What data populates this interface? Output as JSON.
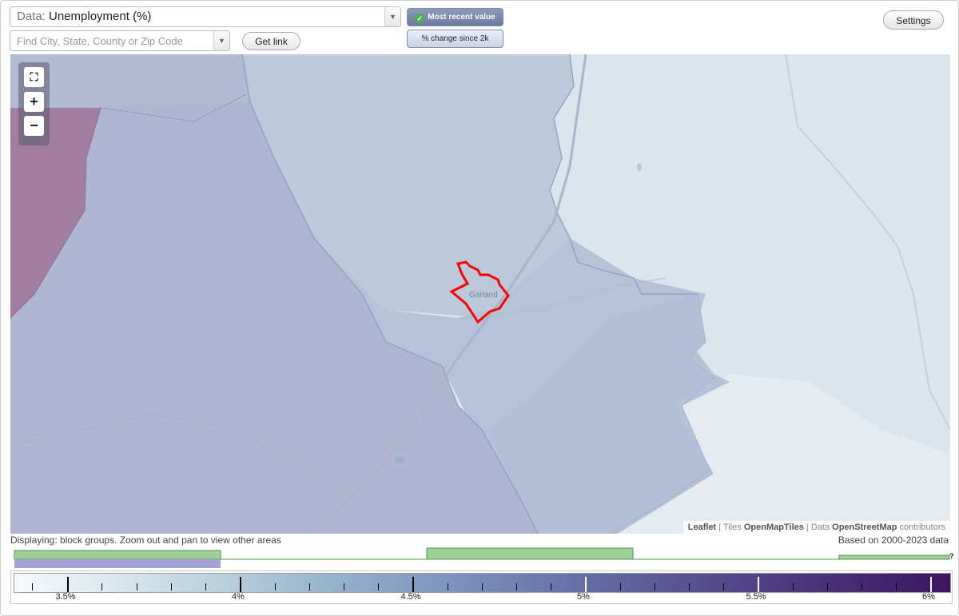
{
  "data_select": {
    "prefix": "Data:",
    "value": "Unemployment (%)"
  },
  "search": {
    "placeholder": "Find City, State, County or Zip Code"
  },
  "buttons": {
    "get_link": "Get link",
    "settings": "Settings"
  },
  "toggles": {
    "most_recent": "Most recent value",
    "pct_change": "% change since 2k"
  },
  "map": {
    "place_label": "Garland",
    "attribution": {
      "leaflet": "Leaflet",
      "tiles_prefix": "Tiles",
      "tiles": "OpenMapTiles",
      "data_prefix": "Data",
      "data": "OpenStreetMap",
      "suffix": "contributors"
    },
    "highlight_color": "#ff0000"
  },
  "status": {
    "displaying": "Displaying: block groups. Zoom out and pan to view other areas",
    "based_on": "Based on 2000-2023 data"
  },
  "legend": {
    "labels": [
      "3.5%",
      "4%",
      "4.5%",
      "5%",
      "5.5%",
      "6%"
    ],
    "help": "?"
  }
}
